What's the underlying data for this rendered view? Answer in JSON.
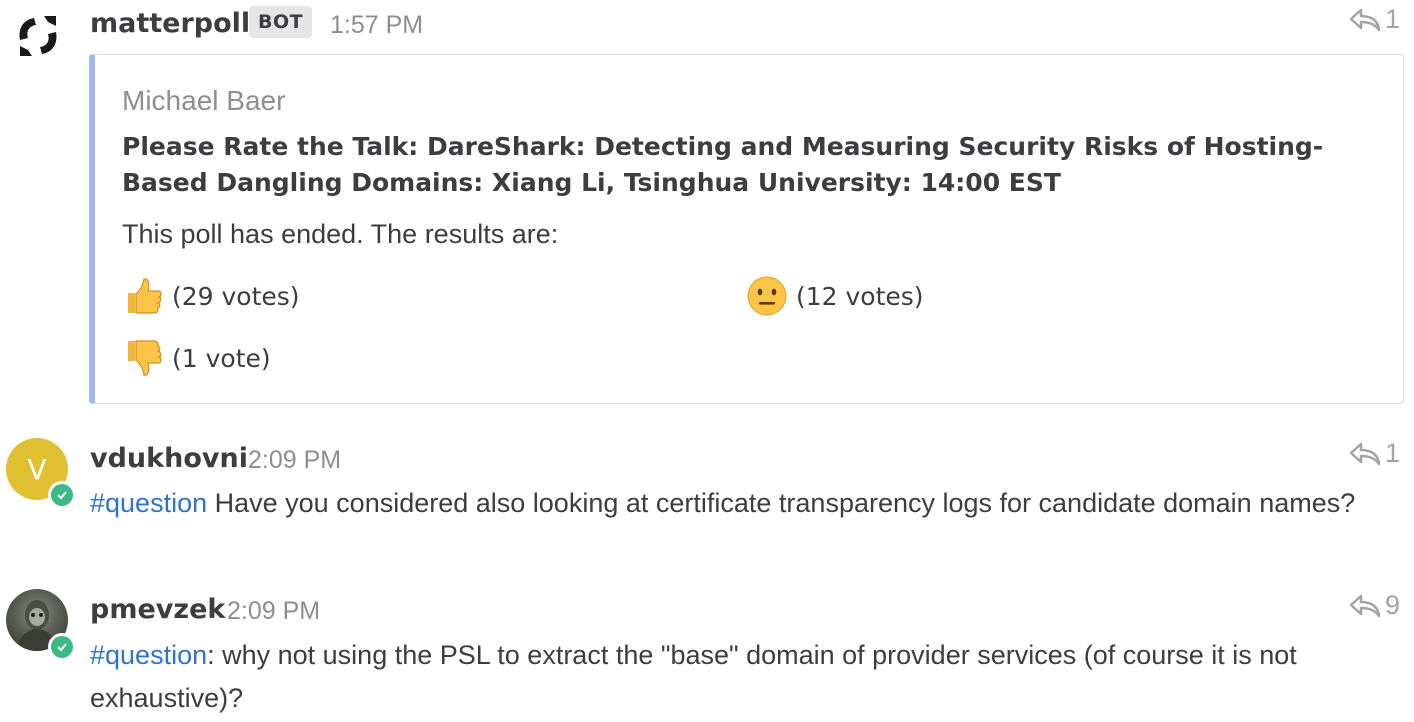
{
  "posts": [
    {
      "username": "matterpoll",
      "badge": "BOT",
      "time": "1:57 PM",
      "reply_count": "1",
      "attachment": {
        "author": "Michael Baer",
        "title": "Please Rate the Talk: DareShark: Detecting and Measuring Security Risks of Hosting-Based Dangling Domains: Xiang Li, Tsinghua University: 14:00 EST",
        "text": "This poll has ended. The results are:",
        "results": [
          {
            "emoji": "thumbs-up",
            "label": "(29 votes)"
          },
          {
            "emoji": "neutral-face",
            "label": "(12 votes)"
          },
          {
            "emoji": "thumbs-down",
            "label": "(1 vote)"
          }
        ]
      }
    },
    {
      "username": "vdukhovni",
      "avatar_letter": "V",
      "avatar_color": "#e0c030",
      "time": "2:09 PM",
      "reply_count": "1",
      "hashtag": "#question",
      "text": " Have you considered also looking at certificate transparency logs for candidate domain names?"
    },
    {
      "username": "pmevzek",
      "time": "2:09 PM",
      "reply_count": "9",
      "hashtag": "#question",
      "text": ": why not using the PSL to extract the \"base\" domain of provider services (of course it is not exhaustive)?"
    }
  ],
  "colors": {
    "accent_link": "#2e72d2",
    "attachment_border": "#a4b8f0",
    "online_status": "#3db887"
  }
}
